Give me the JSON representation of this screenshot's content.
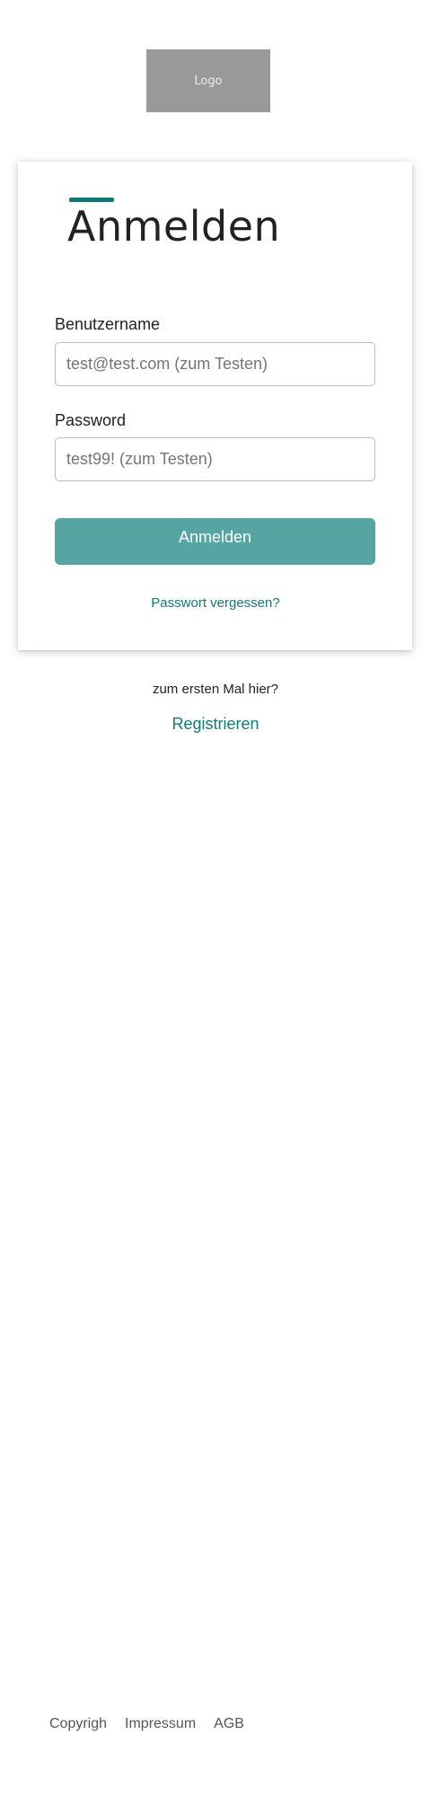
{
  "logo": {
    "text": "Logo"
  },
  "login": {
    "title": "Anmelden",
    "username_label": "Benutzername",
    "username_placeholder": "test@test.com (zum Testen)",
    "password_label": "Password",
    "password_placeholder": "test99! (zum Testen)",
    "submit_label": "Anmelden",
    "forgot_password": "Passwort vergessen?"
  },
  "register": {
    "prompt": "zum ersten Mal hier?",
    "link": "Registrieren"
  },
  "footer": {
    "links": [
      "Copyrigh",
      "Impressum",
      "AGB"
    ]
  },
  "colors": {
    "accent": "#137878",
    "button": "#55a5a2",
    "logo_bg": "#999999"
  }
}
